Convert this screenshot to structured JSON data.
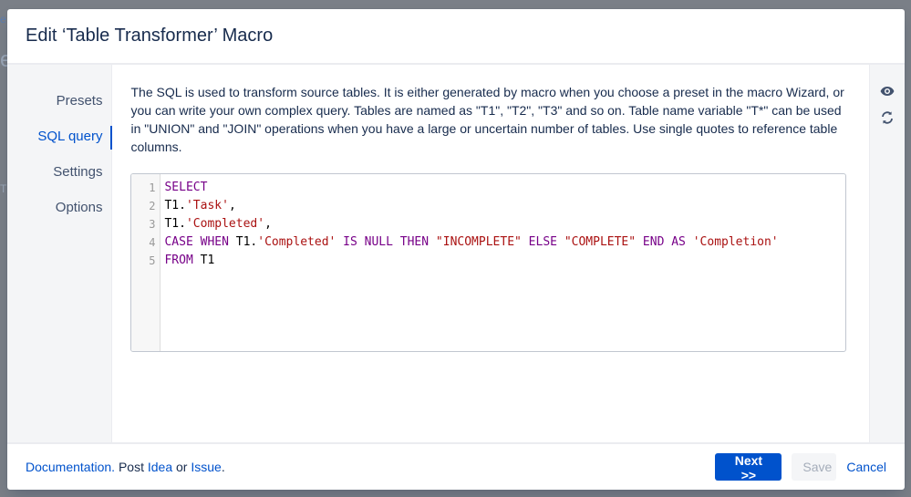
{
  "dialog": {
    "title": "Edit ‘Table Transformer’ Macro"
  },
  "nav": {
    "items": [
      {
        "label": "Presets",
        "active": false
      },
      {
        "label": "SQL query",
        "active": true
      },
      {
        "label": "Settings",
        "active": false
      },
      {
        "label": "Options",
        "active": false
      }
    ]
  },
  "content": {
    "description": "The SQL is used to transform source tables. It is either generated by macro when you choose a preset in the macro Wizard, or you can write your own complex query. Tables are named as \"T1\", \"T2\", \"T3\" and so on. Table name variable \"T*\" can be used in \"UNION\" and \"JOIN\" operations when you have a large or uncertain number of tables. Use single quotes to reference table columns."
  },
  "editor": {
    "line_numbers": [
      "1",
      "2",
      "3",
      "4",
      "5"
    ],
    "lines": [
      [
        {
          "t": "SELECT",
          "c": "kw"
        }
      ],
      [
        {
          "t": "T1.",
          "c": ""
        },
        {
          "t": "'Task'",
          "c": "str"
        },
        {
          "t": ",",
          "c": ""
        }
      ],
      [
        {
          "t": "T1.",
          "c": ""
        },
        {
          "t": "'Completed'",
          "c": "str"
        },
        {
          "t": ",",
          "c": ""
        }
      ],
      [
        {
          "t": "CASE WHEN",
          "c": "kw"
        },
        {
          "t": " T1.",
          "c": ""
        },
        {
          "t": "'Completed'",
          "c": "str"
        },
        {
          "t": " IS NULL THEN ",
          "c": "kw"
        },
        {
          "t": "\"INCOMPLETE\"",
          "c": "str"
        },
        {
          "t": " ELSE ",
          "c": "kw"
        },
        {
          "t": "\"COMPLETE\"",
          "c": "str"
        },
        {
          "t": " END AS ",
          "c": "kw"
        },
        {
          "t": "'Completion'",
          "c": "str"
        }
      ],
      [
        {
          "t": "FROM",
          "c": "kw"
        },
        {
          "t": " T1",
          "c": ""
        }
      ]
    ]
  },
  "tools": {
    "preview_icon": "eye-icon",
    "refresh_icon": "refresh-icon"
  },
  "footer": {
    "documentation": "Documentation.",
    "post": " Post ",
    "idea": "Idea",
    "or": " or ",
    "issue": "Issue",
    "period": ".",
    "next_label": "Next >>",
    "save_label": "Save",
    "cancel_label": "Cancel"
  },
  "colors": {
    "accent": "#0052cc",
    "keyword": "#770088",
    "string": "#aa1111"
  }
}
